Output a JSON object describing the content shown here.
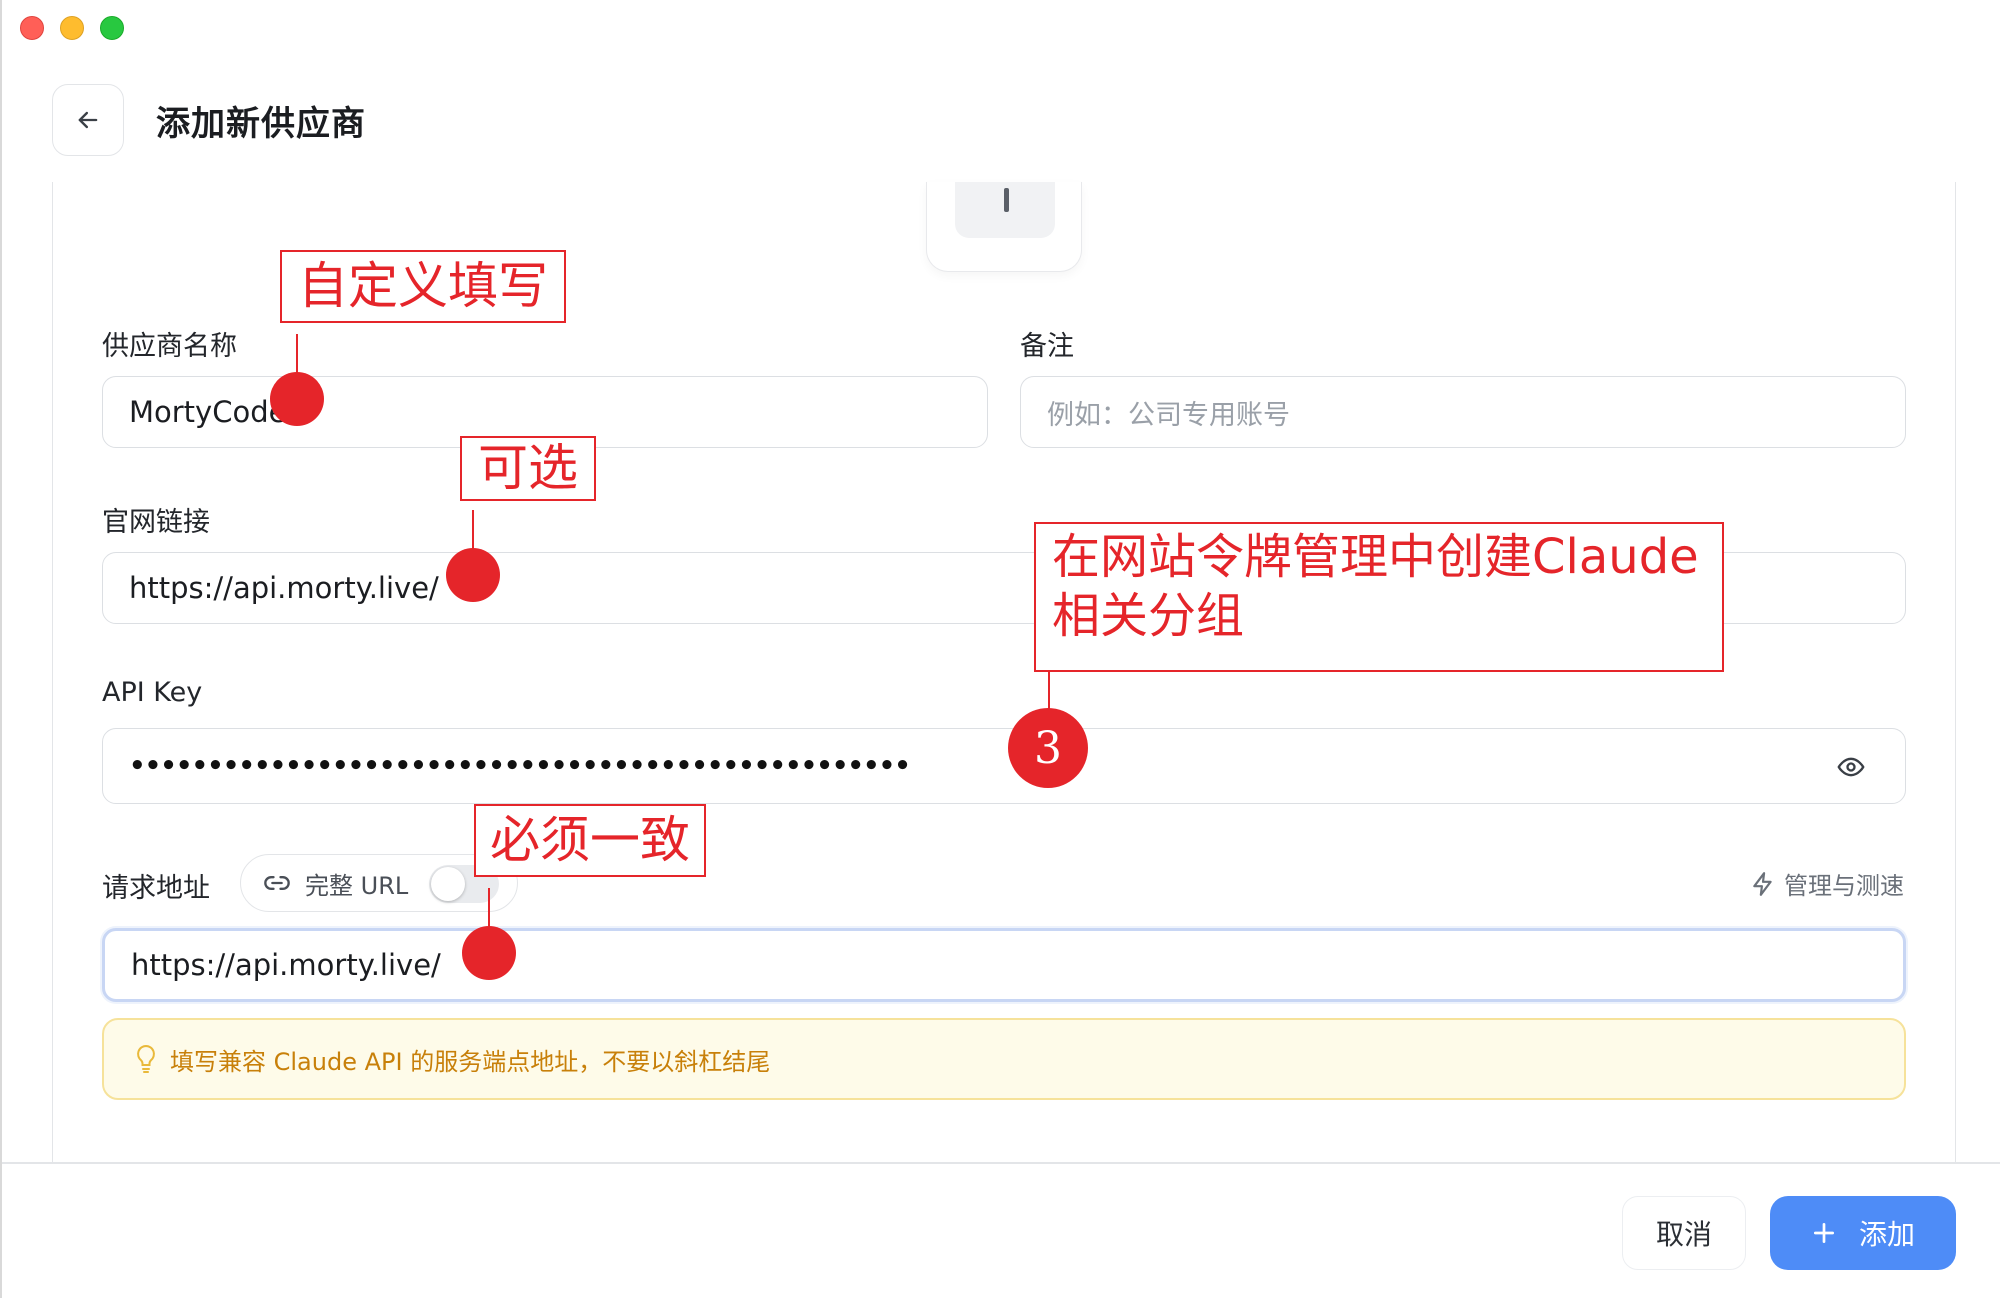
{
  "header": {
    "title": "添加新供应商"
  },
  "form": {
    "provider_name": {
      "label": "供应商名称",
      "value": "MortyCode"
    },
    "note": {
      "label": "备注",
      "placeholder": "例如：公司专用账号"
    },
    "website": {
      "label": "官网链接",
      "value": "https://api.morty.live/"
    },
    "api_key": {
      "label": "API Key",
      "masked": "••••••••••••••••••••••••••••••••••••••••••••••••••"
    },
    "endpoint": {
      "label": "请求地址",
      "toggle_label": "完整 URL",
      "toggle_on": false,
      "manage_label": "管理与测速",
      "value": "https://api.morty.live/"
    },
    "hint": "填写兼容 Claude API 的服务端点地址，不要以斜杠结尾"
  },
  "footer": {
    "cancel_label": "取消",
    "add_label": "添加"
  },
  "annotations": {
    "a1": "自定义填写",
    "a2": "可选",
    "a3_line1": "在网站令牌管理中创建Claude",
    "a3_line2": "相关分组",
    "badge3": "3",
    "a4": "必须一致"
  },
  "colors": {
    "accent": "#4e8cf7",
    "annotation": "#e5252a",
    "hint_text": "#c8800a"
  }
}
